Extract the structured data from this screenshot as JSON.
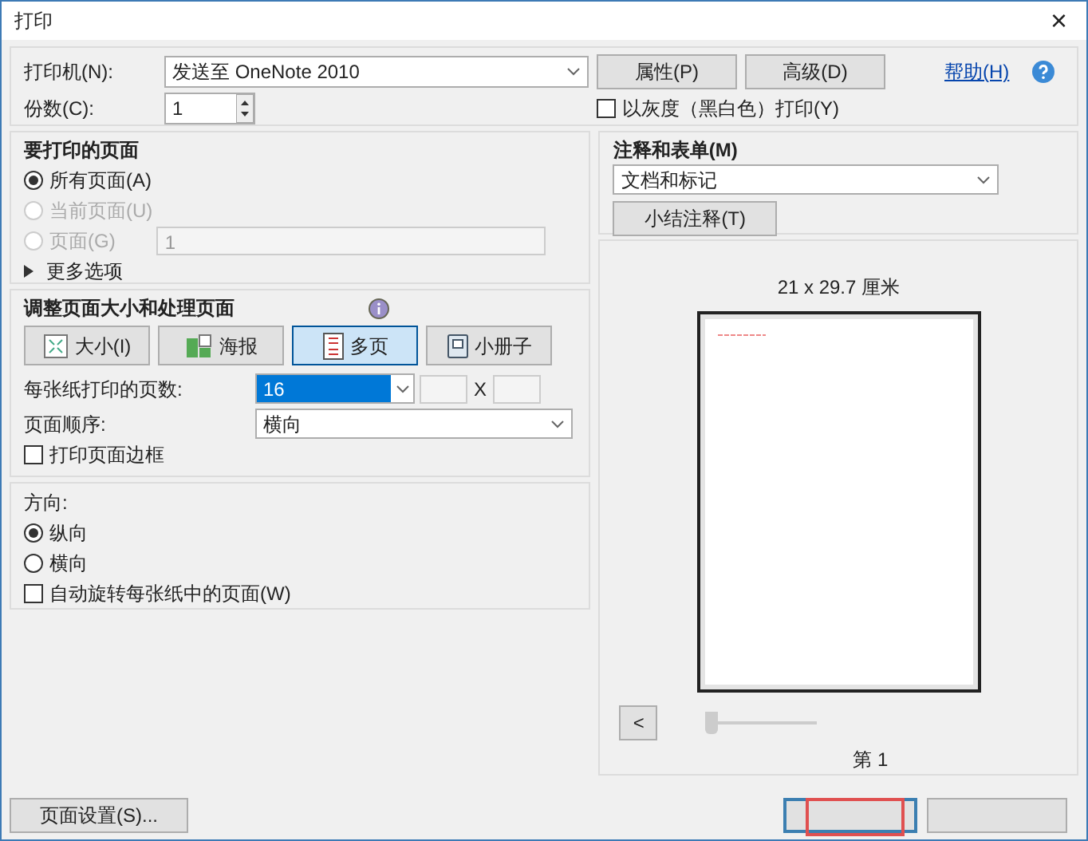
{
  "window": {
    "title": "打印",
    "close": "×"
  },
  "printer": {
    "label": "打印机(N):",
    "value": "发送至 OneNote 2010",
    "properties_button": "属性(P)",
    "advanced_button": "高级(D)",
    "help_link": "帮助(H)"
  },
  "copies": {
    "label": "份数(C):",
    "value": "1"
  },
  "grayscale": {
    "label": "以灰度（黑白色）打印(Y)",
    "checked": false
  },
  "pages_to_print": {
    "title": "要打印的页面",
    "options": [
      {
        "label": "所有页面(A)",
        "selected": true,
        "disabled": false
      },
      {
        "label": "当前页面(U)",
        "selected": false,
        "disabled": true
      },
      {
        "label": "页面(G)",
        "selected": false,
        "disabled": true,
        "field": "1"
      }
    ],
    "more_options": "更多选项"
  },
  "page_sizing": {
    "title": "调整页面大小和处理页面",
    "modes": [
      {
        "label": "大小(I)",
        "selected": false,
        "kind": "size"
      },
      {
        "label": "海报",
        "selected": false,
        "kind": "poster"
      },
      {
        "label": "多页",
        "selected": true,
        "kind": "multiple"
      },
      {
        "label": "小册子",
        "selected": false,
        "kind": "booklet"
      }
    ],
    "pages_per_sheet": {
      "label": "每张纸打印的页数:",
      "value": "16",
      "x": "X"
    },
    "page_order": {
      "label": "页面顺序:",
      "value": "横向"
    },
    "print_border": {
      "label": "打印页面边框",
      "checked": false
    }
  },
  "orientation": {
    "title": "方向:",
    "options": [
      {
        "label": "纵向",
        "selected": true
      },
      {
        "label": "横向",
        "selected": false
      }
    ],
    "auto_rotate": {
      "label": "自动旋转每张纸中的页面(W)",
      "checked": false
    }
  },
  "comments": {
    "title": "注释和表单(M)",
    "value": "文档和标记",
    "summarize_button": "小结注释(T)"
  },
  "preview": {
    "size": "21 x 29.7 厘米",
    "prev_button": "<",
    "slider": {
      "level": 0
    },
    "page_text": "第 1"
  },
  "page_setup_button": "页面设置(S)..."
}
